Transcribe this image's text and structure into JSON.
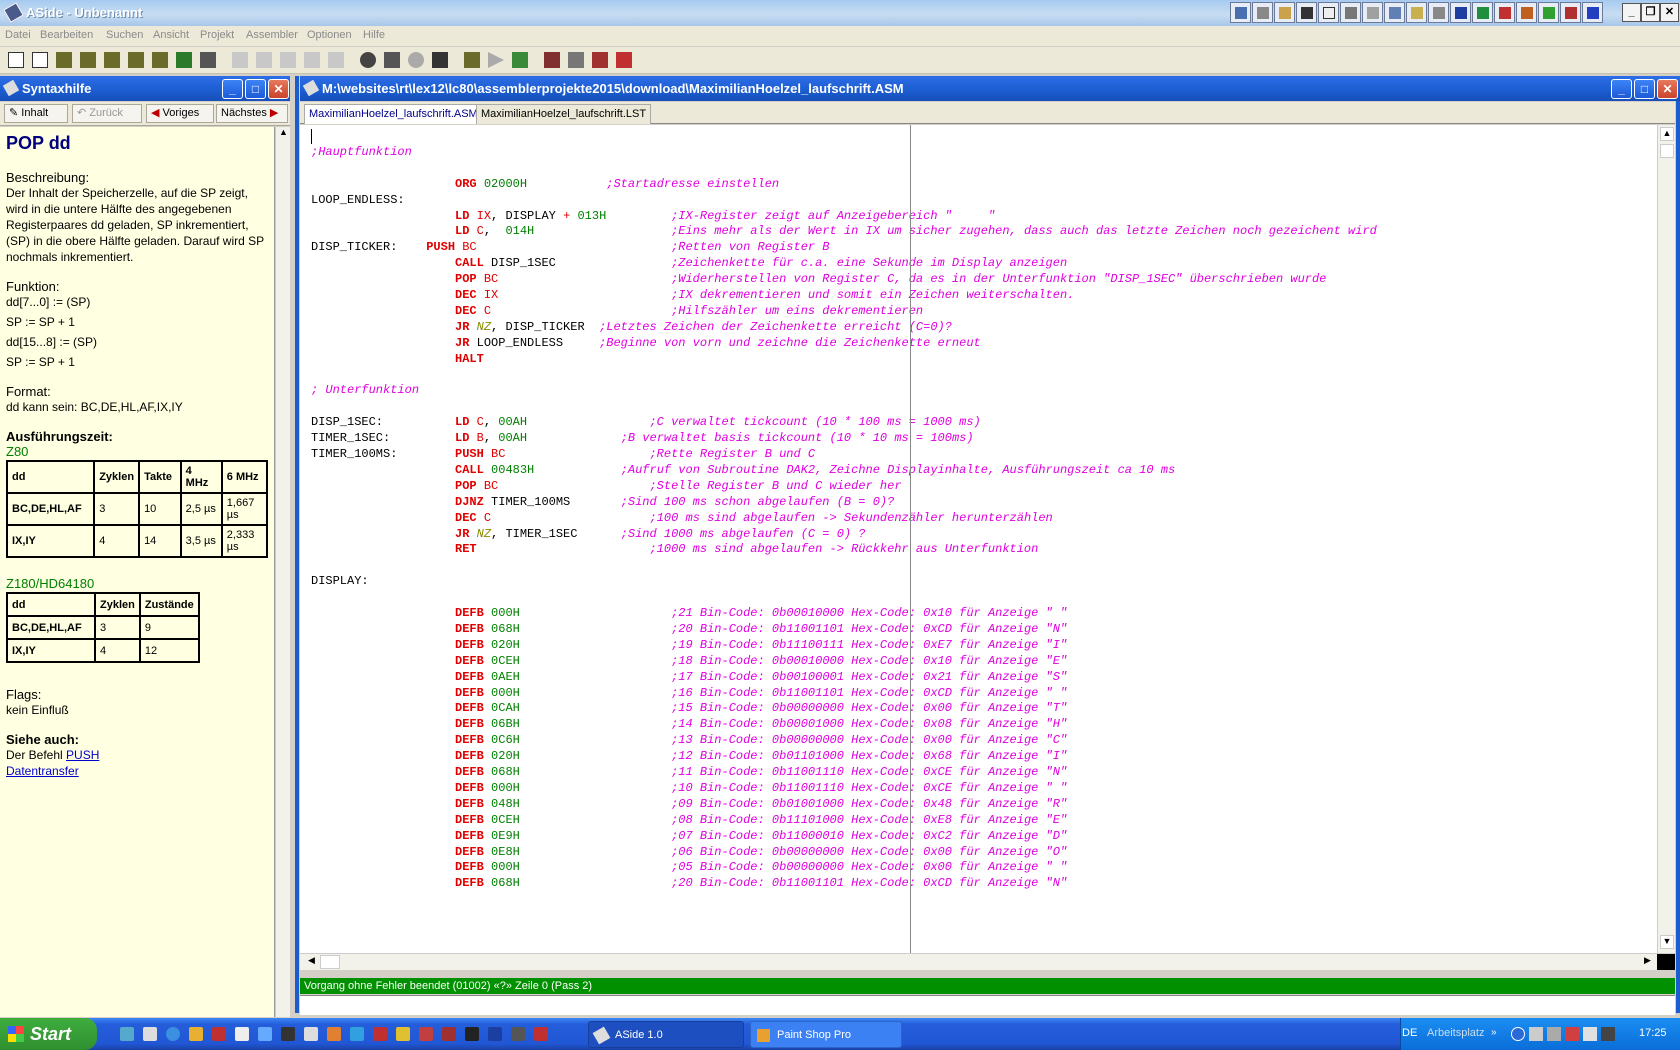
{
  "app": {
    "title": "ASide - Unbenannt",
    "menu": [
      "Datei",
      "Bearbeiten",
      "Suchen",
      "Ansicht",
      "Projekt",
      "Assembler",
      "Optionen",
      "Hilfe"
    ]
  },
  "syntax_pane": {
    "title": "Syntaxhilfe",
    "nav": {
      "contents": "Inhalt",
      "back": "Zurück",
      "prev": "Voriges",
      "next": "Nächstes"
    },
    "heading": "POP dd",
    "beschreibung_label": "Beschreibung:",
    "beschreibung_text": "Der Inhalt der Speicherzelle, auf die SP zeigt, wird in die untere Hälfte des angegebenen Registerpaares dd geladen, SP inkrementiert, (SP) in die obere Hälfte geladen. Darauf wird SP nochmals inkrementiert.",
    "funktion_label": "Funktion:",
    "funktion_lines": [
      "dd[7...0] := (SP)",
      "SP := SP + 1",
      "dd[15...8] := (SP)",
      "SP := SP + 1"
    ],
    "format_label": "Format:",
    "format_text": "dd kann sein: BC,DE,HL,AF,IX,IY",
    "ausfuehrung_label": "Ausführungszeit:",
    "z80_label": "Z80",
    "z80_table": {
      "header": [
        "dd",
        "Zyklen",
        "Takte",
        "4 MHz",
        "6 MHz"
      ],
      "rows": [
        [
          "BC,DE,HL,AF",
          "3",
          "10",
          "2,5 µs",
          "1,667 µs"
        ],
        [
          "IX,IY",
          "4",
          "14",
          "3,5 µs",
          "2,333 µs"
        ]
      ]
    },
    "z180_label": "Z180/HD64180",
    "z180_table": {
      "header": [
        "dd",
        "Zyklen",
        "Zustände"
      ],
      "rows": [
        [
          "BC,DE,HL,AF",
          "3",
          "9"
        ],
        [
          "IX,IY",
          "4",
          "12"
        ]
      ]
    },
    "flags_label": "Flags:",
    "flags_text": "kein Einfluß",
    "siehe_label": "Siehe auch:",
    "siehe_prefix": "Der Befehl ",
    "siehe_link1": "PUSH",
    "siehe_link2": "Datentransfer"
  },
  "editor": {
    "title": "M:\\websites\\rt\\lex12\\lc80\\assemblerprojekte2015\\download\\MaximilianHoelzel_laufschrift.ASM",
    "tabs": [
      "MaximilianHoelzel_laufschrift.ASM",
      "MaximilianHoelzel_laufschrift.LST"
    ],
    "status": "Vorgang ohne Fehler beendet (01002) «?» Zeile 0 (Pass 2)",
    "code_lines": [
      "",
      ";Hauptfunktion",
      "",
      "                    ORG 02000H           ;Startadresse einstellen",
      "LOOP_ENDLESS:",
      "                    LD IX, DISPLAY + 013H         ;IX-Register zeigt auf Anzeigebereich \"     \"",
      "                    LD C,  014H                   ;Eins mehr als der Wert in IX um sicher zugehen, dass auch das letzte Zeichen noch gezeichent wird",
      "DISP_TICKER:    PUSH BC                           ;Retten von Register B",
      "                    CALL DISP_1SEC                ;Zeichenkette für c.a. eine Sekunde im Display anzeigen",
      "                    POP BC                        ;Widerherstellen von Register C, da es in der Unterfunktion \"DISP_1SEC\" überschrieben wurde",
      "                    DEC IX                        ;IX dekrementieren und somit ein Zeichen weiterschalten.",
      "                    DEC C                         ;Hilfszähler um eins dekrementieren",
      "                    JR NZ, DISP_TICKER  ;Letztes Zeichen der Zeichenkette erreicht (C=0)?",
      "                    JR LOOP_ENDLESS     ;Beginne von vorn und zeichne die Zeichenkette erneut",
      "                    HALT",
      "",
      "; Unterfunktion",
      "",
      "DISP_1SEC:          LD C, 00AH                 ;C verwaltet tickcount (10 * 100 ms = 1000 ms)",
      "TIMER_1SEC:         LD B, 00AH             ;B verwaltet basis tickcount (10 * 10 ms = 100ms)",
      "TIMER_100MS:        PUSH BC                    ;Rette Register B und C",
      "                    CALL 00483H            ;Aufruf von Subroutine DAK2, Zeichne Displayinhalte, Ausführungszeit ca 10 ms",
      "                    POP BC                     ;Stelle Register B und C wieder her",
      "                    DJNZ TIMER_100MS       ;Sind 100 ms schon abgelaufen (B = 0)?",
      "                    DEC C                      ;100 ms sind abgelaufen -> Sekundenzähler herunterzählen",
      "                    JR NZ, TIMER_1SEC      ;Sind 1000 ms abgelaufen (C = 0) ?",
      "                    RET                        ;1000 ms sind abgelaufen -> Rückkehr aus Unterfunktion",
      "",
      "DISPLAY:",
      "",
      "                    DEFB 000H                     ;21 Bin-Code: 0b00010000 Hex-Code: 0x10 für Anzeige \" \"",
      "                    DEFB 068H                     ;20 Bin-Code: 0b11001101 Hex-Code: 0xCD für Anzeige \"N\"",
      "                    DEFB 020H                     ;19 Bin-Code: 0b11100111 Hex-Code: 0xE7 für Anzeige \"I\"",
      "                    DEFB 0CEH                     ;18 Bin-Code: 0b00010000 Hex-Code: 0x10 für Anzeige \"E\"",
      "                    DEFB 0AEH                     ;17 Bin-Code: 0b00100001 Hex-Code: 0x21 für Anzeige \"S\"",
      "                    DEFB 000H                     ;16 Bin-Code: 0b11001101 Hex-Code: 0xCD für Anzeige \" \"",
      "                    DEFB 0CAH                     ;15 Bin-Code: 0b00000000 Hex-Code: 0x00 für Anzeige \"T\"",
      "                    DEFB 06BH                     ;14 Bin-Code: 0b00001000 Hex-Code: 0x08 für Anzeige \"H\"",
      "                    DEFB 0C6H                     ;13 Bin-Code: 0b00000000 Hex-Code: 0x00 für Anzeige \"C\"",
      "                    DEFB 020H                     ;12 Bin-Code: 0b01101000 Hex-Code: 0x68 für Anzeige \"I\"",
      "                    DEFB 068H                     ;11 Bin-Code: 0b11001110 Hex-Code: 0xCE für Anzeige \"N\"",
      "                    DEFB 000H                     ;10 Bin-Code: 0b11001110 Hex-Code: 0xCE für Anzeige \" \"",
      "                    DEFB 048H                     ;09 Bin-Code: 0b01001000 Hex-Code: 0x48 für Anzeige \"R\"",
      "                    DEFB 0CEH                     ;08 Bin-Code: 0b11101000 Hex-Code: 0xE8 für Anzeige \"E\"",
      "                    DEFB 0E9H                     ;07 Bin-Code: 0b11000010 Hex-Code: 0xC2 für Anzeige \"D\"",
      "                    DEFB 0E8H                     ;06 Bin-Code: 0b00000000 Hex-Code: 0x00 für Anzeige \"O\"",
      "                    DEFB 000H                     ;05 Bin-Code: 0b00000000 Hex-Code: 0x00 für Anzeige \" \"",
      "                    DEFB 068H                     ;20 Bin-Code: 0b11001101 Hex-Code: 0xCD für Anzeige \"N\""
    ]
  },
  "taskbar": {
    "start": "Start",
    "tasks": [
      "ASide 1.0",
      "Paint Shop Pro"
    ],
    "lang": "DE",
    "arbeitsplatz": "Arbeitsplatz",
    "clock": "17:25"
  },
  "colors": {
    "keyword": "#e00000",
    "number": "#008000",
    "comment": "#e000e0",
    "status_bg": "#009000",
    "titlebar": "#1b5ccf"
  }
}
